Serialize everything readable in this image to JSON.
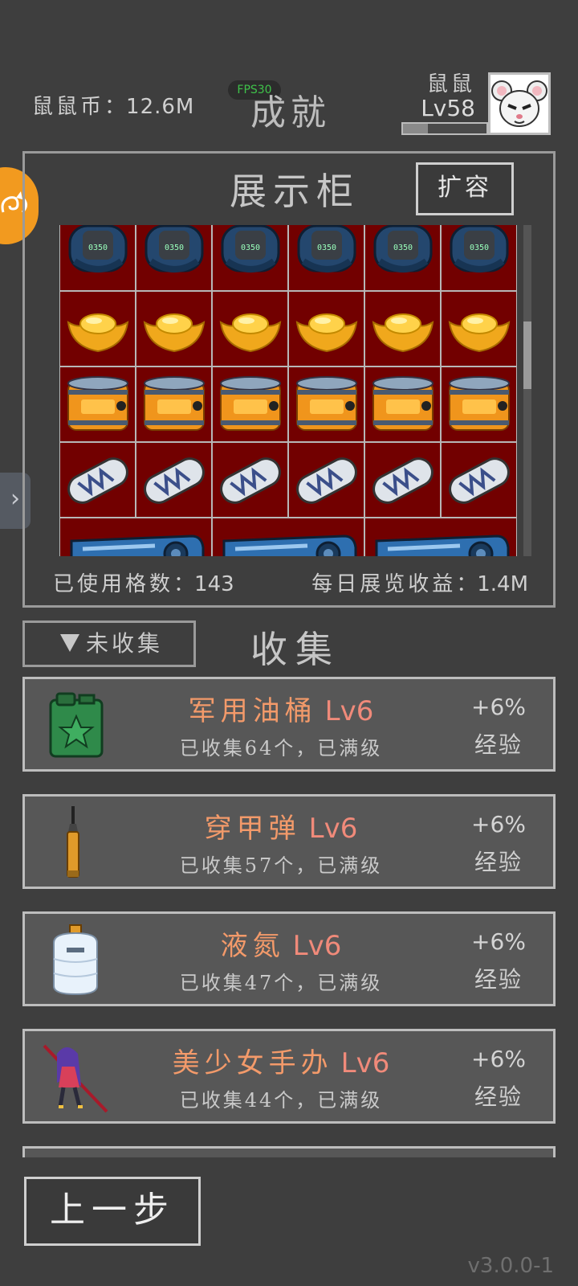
{
  "header": {
    "coins_label": "鼠鼠币",
    "coins_sep": "：",
    "coins_value": "12.6M",
    "fps": "FPS30",
    "page_title": "成就",
    "player_name": "鼠鼠",
    "player_level": "Lv58",
    "xp_progress": 0.3,
    "avatar_icon": "mouse-avatar-icon"
  },
  "side": {
    "left_tab_icon": "swirl-emblem-icon",
    "expand_icon": "chevron-right-icon",
    "expand_glyph": "›"
  },
  "display": {
    "title": "展示柜",
    "expand_button": "扩容",
    "used_slots_label": "已使用格数",
    "used_slots_sep": "：",
    "used_slots_value": "143",
    "daily_income_label": "每日展览收益",
    "daily_income_sep": "：",
    "daily_income_value": "1.4M",
    "rows": [
      {
        "item": "watch",
        "count": 6
      },
      {
        "item": "gold-ingot",
        "count": 6
      },
      {
        "item": "canister",
        "count": 6
      },
      {
        "item": "capsule",
        "count": 6
      },
      {
        "item": "graphics-card",
        "count": 3
      }
    ]
  },
  "collection": {
    "filter_label": "未收集",
    "title": "收集",
    "cards": [
      {
        "icon": "jerry-can-icon",
        "name": "军用油桶",
        "level": "Lv6",
        "status": "已收集64个，已满级",
        "bonus": "+6%",
        "bonus_type": "经验"
      },
      {
        "icon": "armor-piercing-round-icon",
        "name": "穿甲弹",
        "level": "Lv6",
        "status": "已收集57个，已满级",
        "bonus": "+6%",
        "bonus_type": "经验"
      },
      {
        "icon": "liquid-nitrogen-tank-icon",
        "name": "液氮",
        "level": "Lv6",
        "status": "已收集47个，已满级",
        "bonus": "+6%",
        "bonus_type": "经验"
      },
      {
        "icon": "anime-figure-icon",
        "name": "美少女手办",
        "level": "Lv6",
        "status": "已收集44个，已满级",
        "bonus": "+6%",
        "bonus_type": "经验"
      }
    ]
  },
  "footer": {
    "back_button": "上一步",
    "version": "v3.0.0-1"
  }
}
